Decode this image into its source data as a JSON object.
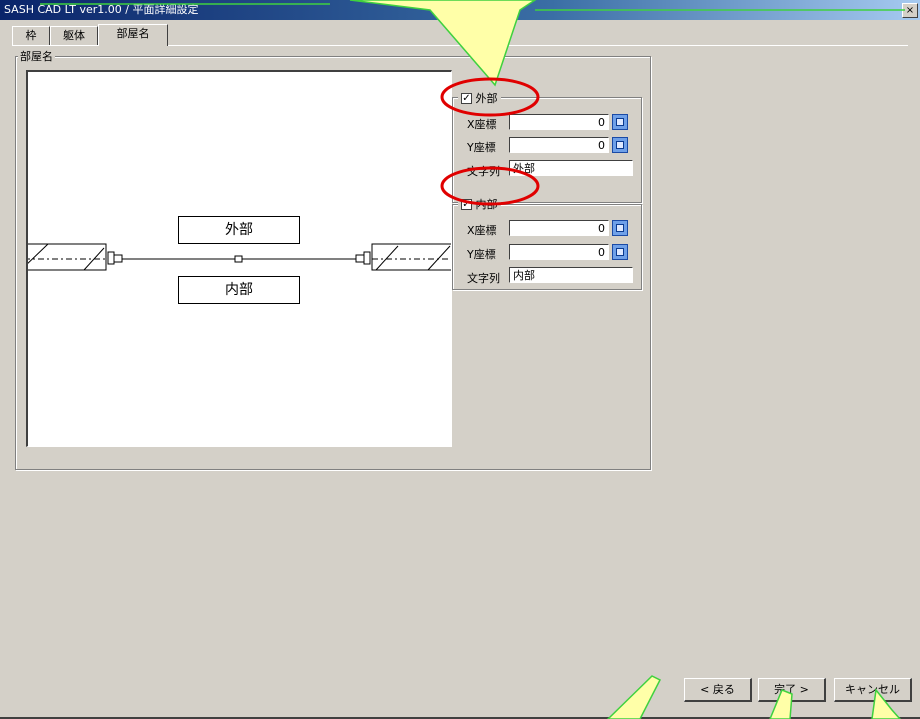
{
  "window": {
    "title": "SASH CAD LT ver1.00 / 平面詳細設定",
    "close_glyph": "×"
  },
  "tabs": [
    {
      "label": "枠"
    },
    {
      "label": "躯体"
    },
    {
      "label": "部屋名"
    }
  ],
  "group_title": "部屋名",
  "preview": {
    "outer_label": "外部",
    "inner_label": "内部"
  },
  "outer": {
    "checkbox_label": "外部",
    "checked": true,
    "check_glyph": "✓",
    "x_label": "X座標",
    "x_value": "0",
    "y_label": "Y座標",
    "y_value": "0",
    "text_label": "文字列",
    "text_value": "外部"
  },
  "inner": {
    "checkbox_label": "内部",
    "checked": true,
    "check_glyph": "✓",
    "x_label": "X座標",
    "x_value": "0",
    "y_label": "Y座標",
    "y_value": "0",
    "text_label": "文字列",
    "text_value": "内部"
  },
  "buttons": {
    "back": "< 戻る",
    "finish": "完了 >",
    "cancel": "キャンセル"
  },
  "annotation_colors": {
    "callout_fill": "#ffffa8",
    "callout_stroke": "#3fd13f",
    "circle": "#e00000"
  },
  "icons": {
    "calculator": "calculator-icon",
    "close": "close-icon"
  }
}
